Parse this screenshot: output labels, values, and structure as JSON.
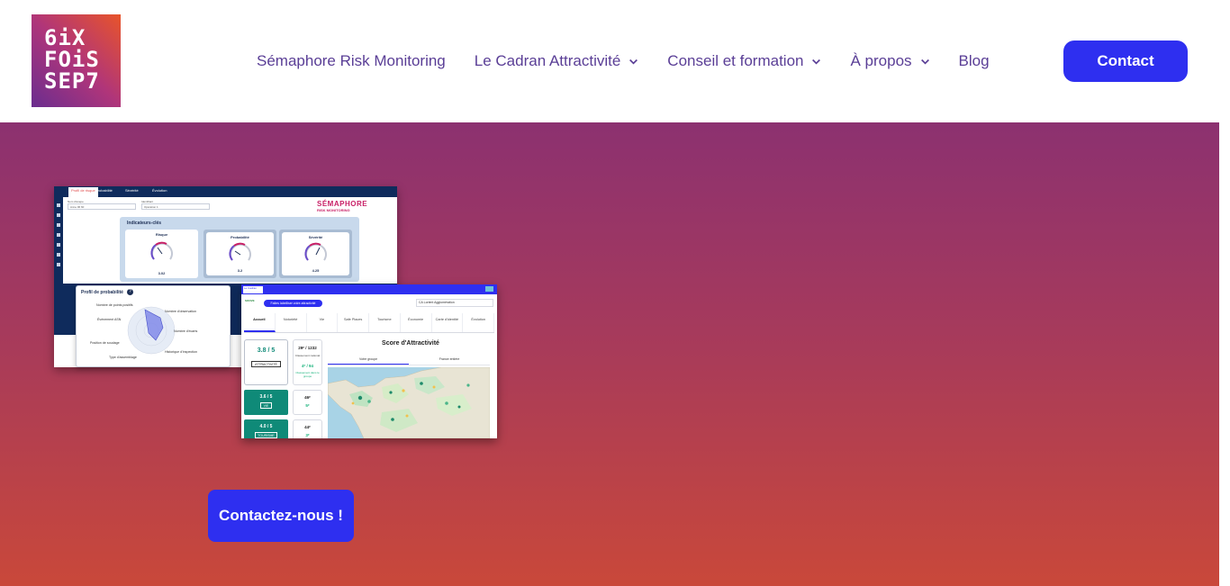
{
  "header": {
    "logo_text": [
      "6iX",
      "FOiS",
      "SEP7"
    ],
    "nav": [
      {
        "label": "Sémaphore Risk Monitoring",
        "has_dropdown": false
      },
      {
        "label": "Le Cadran Attractivité",
        "has_dropdown": true
      },
      {
        "label": "Conseil et formation",
        "has_dropdown": true
      },
      {
        "label": "À propos",
        "has_dropdown": true
      },
      {
        "label": "Blog",
        "has_dropdown": false
      }
    ],
    "contact_label": "Contact"
  },
  "hero": {
    "cta_label": "Contactez-nous !"
  },
  "semaphore_screenshot": {
    "tabs": [
      "Profil de risque",
      "Probabilité",
      "Sévérité",
      "Évolution"
    ],
    "filter1_label": "Nom d'anepe",
    "filter1_value": "Anne 06 60",
    "filter2_label": "Identifiant",
    "filter2_value": "Opération 1",
    "brand_top": "SÉMAPHORE",
    "brand_bottom": "RISK MONITORING",
    "panel_title": "Indicateurs-clés",
    "gauges": [
      {
        "title": "Risque",
        "value": "3.02"
      },
      {
        "title": "Probabilité",
        "value": "3.2"
      },
      {
        "title": "Sévérité",
        "value": "4.25"
      }
    ],
    "prob_title": "Profil de probabilité",
    "prob_help": "?",
    "radar_labels": [
      "Nombre de points positifs",
      "Nombre d'observation",
      "Événement ASN",
      "Nombre d'écarts",
      "Position de soudage",
      "Historique d'inspection",
      "Type d'assemblage"
    ]
  },
  "cadran_screenshot": {
    "top_logo": "Le Cadran",
    "pill_label": "Faites labelliser votre attractivité",
    "logo_small": "SOOVE",
    "select_value": "CA Lorient Agglomération",
    "tabs": [
      "Accueil",
      "Notoriété",
      "Vie",
      "Safe Places",
      "Tourisme",
      "Économie",
      "Carte d'identité",
      "Évolution"
    ],
    "main_score": "3.8 / 5",
    "main_label": "ATTRACTIVITÉ",
    "rank_a": "29ᵉ / 1232",
    "rank_b": "Classement national",
    "rank_c": "4ᵉ / 94",
    "rank_d": "Classement dans le groupe",
    "sub_scores": [
      {
        "value": "3.6 / 5",
        "label": "VIE",
        "rank_a": "46ᵉ",
        "rank_c": "5ᵉ"
      },
      {
        "value": "4.0 / 5",
        "label": "TOURISME",
        "rank_a": "44ᵉ",
        "rank_c": "3ᵉ"
      }
    ],
    "title": "Score d'Attractivité",
    "subtabs": [
      "Votre groupe",
      "France entière"
    ]
  },
  "colors": {
    "accent_blue": "#2e2ff0",
    "nav_purple": "#5a3e96",
    "hero_top": "#8c3170",
    "hero_bottom": "#c9483a",
    "teal": "#0f8a78"
  }
}
